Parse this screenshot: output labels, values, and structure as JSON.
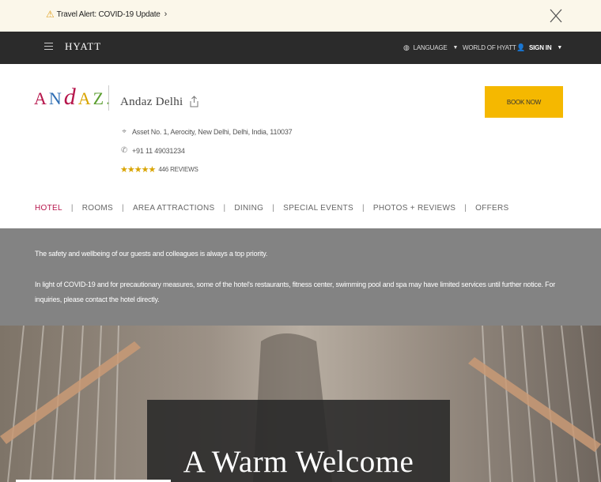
{
  "alert": {
    "text": "Travel Alert: COVID-19 Update",
    "icon": "warning-icon",
    "accent": "#e0a020"
  },
  "nav": {
    "logo": "HYATT",
    "language": "LANGUAGE",
    "world": "WORLD OF HYATT",
    "signin": "SIGN IN"
  },
  "hotel": {
    "logo_letters": [
      "A",
      "N",
      "d",
      "A",
      "Z."
    ],
    "name": "Andaz Delhi",
    "address": "Asset No. 1, Aerocity, New Delhi, Delhi, India, 110037",
    "phone": "+91 11 49031234",
    "rating": 4.5,
    "stars_display": "★★★★★",
    "reviews": "446 REVIEWS",
    "book_label": "BOOK NOW",
    "book_color": "#f5b800"
  },
  "tabs": [
    {
      "label": "HOTEL",
      "active": true
    },
    {
      "label": "ROOMS",
      "active": false
    },
    {
      "label": "AREA ATTRACTIONS",
      "active": false
    },
    {
      "label": "DINING",
      "active": false
    },
    {
      "label": "SPECIAL EVENTS",
      "active": false
    },
    {
      "label": "PHOTOS + REVIEWS",
      "active": false
    },
    {
      "label": "OFFERS",
      "active": false
    }
  ],
  "notice": {
    "p1": "The safety and wellbeing of our guests and colleagues is always a top priority.",
    "p2": "In light of COVID-19 and for precautionary measures, some of the hotel's restaurants, fitness center, swimming pool and spa may have limited services until further notice. For inquiries, please contact the hotel directly."
  },
  "hero": {
    "title": "A Warm Welcome"
  },
  "colors": {
    "brand": "#b6154b",
    "navbar": "#2b2b2b",
    "notice_bg": "#838383"
  }
}
